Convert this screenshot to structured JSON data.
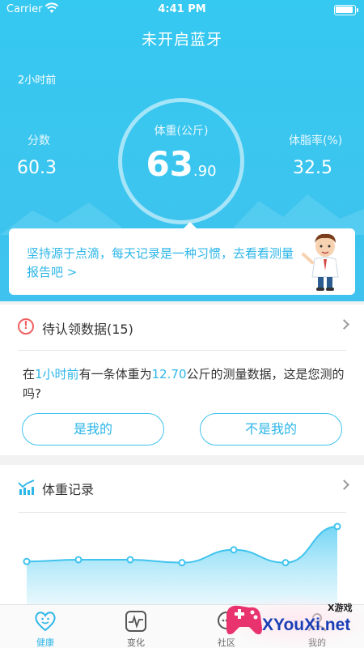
{
  "status_bar": {
    "carrier": "Carrier",
    "time": "4:41 PM"
  },
  "header": {
    "title": "未开启蓝牙",
    "time_ago": "2小时前",
    "score_label": "分数",
    "score_value": "60.3",
    "weight_label": "体重(公斤)",
    "weight_int": "63",
    "weight_dec": ".90",
    "bodyfat_label": "体脂率(%)",
    "bodyfat_value": "32.5"
  },
  "tip": {
    "text": "坚持源于点滴，每天记录是一种习惯，去看看测量报告吧 >"
  },
  "pending": {
    "title": "待认领数据(15)",
    "q_prefix": "在",
    "q_time": "1小时前",
    "q_mid": "有一条体重为",
    "q_weight": "12.70",
    "q_suffix": "公斤的测量数据，这是您测的吗?",
    "yes_label": "是我的",
    "no_label": "不是我的"
  },
  "weight_record": {
    "title": "体重记录"
  },
  "chart_data": {
    "type": "area",
    "x": [
      1,
      2,
      3,
      4,
      5,
      6,
      7
    ],
    "values": [
      0.4,
      0.43,
      0.43,
      0.38,
      0.6,
      0.38,
      1.0
    ]
  },
  "tabs": [
    {
      "label": "健康",
      "icon": "heart-face-icon"
    },
    {
      "label": "变化",
      "icon": "pulse-icon"
    },
    {
      "label": "社区",
      "icon": "chat-icon"
    },
    {
      "label": "我的",
      "icon": "user-icon"
    }
  ],
  "watermark": {
    "text": "XYouXi.net",
    "small": "X游戏"
  },
  "colors": {
    "primary": "#3fc3ee",
    "accent_text": "#2db6e8",
    "warning": "#f06060"
  }
}
